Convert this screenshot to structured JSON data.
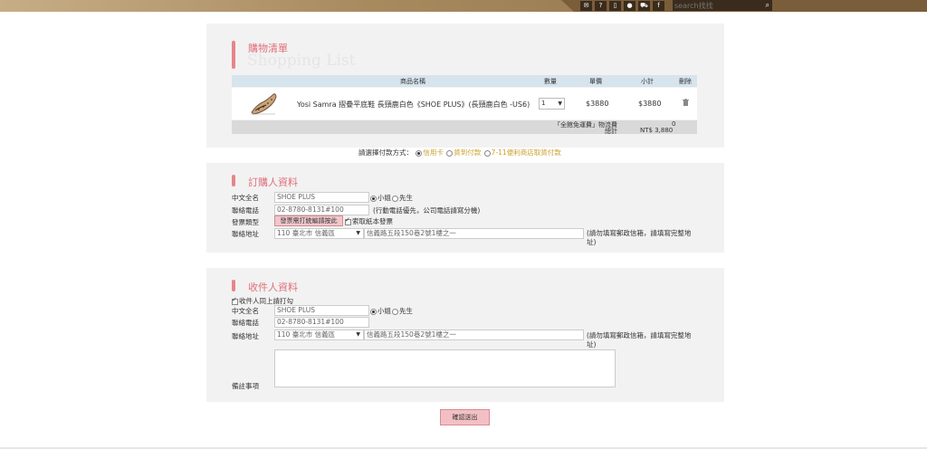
{
  "topbar": {
    "icons": [
      "mail-icon",
      "help-icon",
      "document-icon",
      "user-icon",
      "cart-icon",
      "facebook-icon"
    ],
    "search_placeholder": "search找找"
  },
  "cart": {
    "title_cn": "購物清單",
    "title_en": "Shopping List",
    "headers": {
      "name": "商品名稱",
      "qty": "數量",
      "price": "單價",
      "subtotal": "小計",
      "delete": "刪除"
    },
    "items": [
      {
        "name": "Yosi Samra 摺疊平底鞋 長頸鹿白色《SHOE PLUS》(長頸鹿白色 -US6)",
        "qty": "1",
        "price": "$3880",
        "subtotal": "$3880"
      }
    ],
    "shipping_label": "「全館免運費」物流費",
    "shipping_value": "0",
    "total_label": "總計",
    "total_value": "NT$ 3,880"
  },
  "payment": {
    "prompt": "請選擇付款方式：",
    "options": [
      "信用卡",
      "貨到付款",
      "7-11便利商店取貨付款"
    ],
    "selected": "信用卡"
  },
  "buyer": {
    "title": "訂購人資料",
    "name_label": "中文全名",
    "name_value": "SHOE PLUS",
    "gender_female": "小姐",
    "gender_male": "先生",
    "phone_label": "聯絡電話",
    "phone_value": "02-8780-8131#100",
    "phone_note": "(行動電話優先，公司電話請寫分機)",
    "invoice_label": "發票類型",
    "invoice_button": "發票需打統編請按此",
    "invoice_paper": "索取紙本發票",
    "address_label": "聯絡地址",
    "address_district": "110 臺北市 信義區",
    "address_value": "信義路五段150巷2號1樓之一",
    "address_note": "(請勿填寫郵政信箱，請填寫完整地址)"
  },
  "receiver": {
    "title": "收件人資料",
    "same_as_buyer": "收件人同上請打勾",
    "name_label": "中文全名",
    "name_value": "SHOE PLUS",
    "gender_female": "小姐",
    "gender_male": "先生",
    "phone_label": "聯絡電話",
    "phone_value": "02-8780-8131#100",
    "address_label": "聯絡地址",
    "address_district": "110 臺北市 信義區",
    "address_value": "信義路五段150巷2號1樓之一",
    "address_note": "(請勿填寫郵政信箱，請填寫完整地址)",
    "remarks_label": "備註事項"
  },
  "submit_label": "確認送出"
}
